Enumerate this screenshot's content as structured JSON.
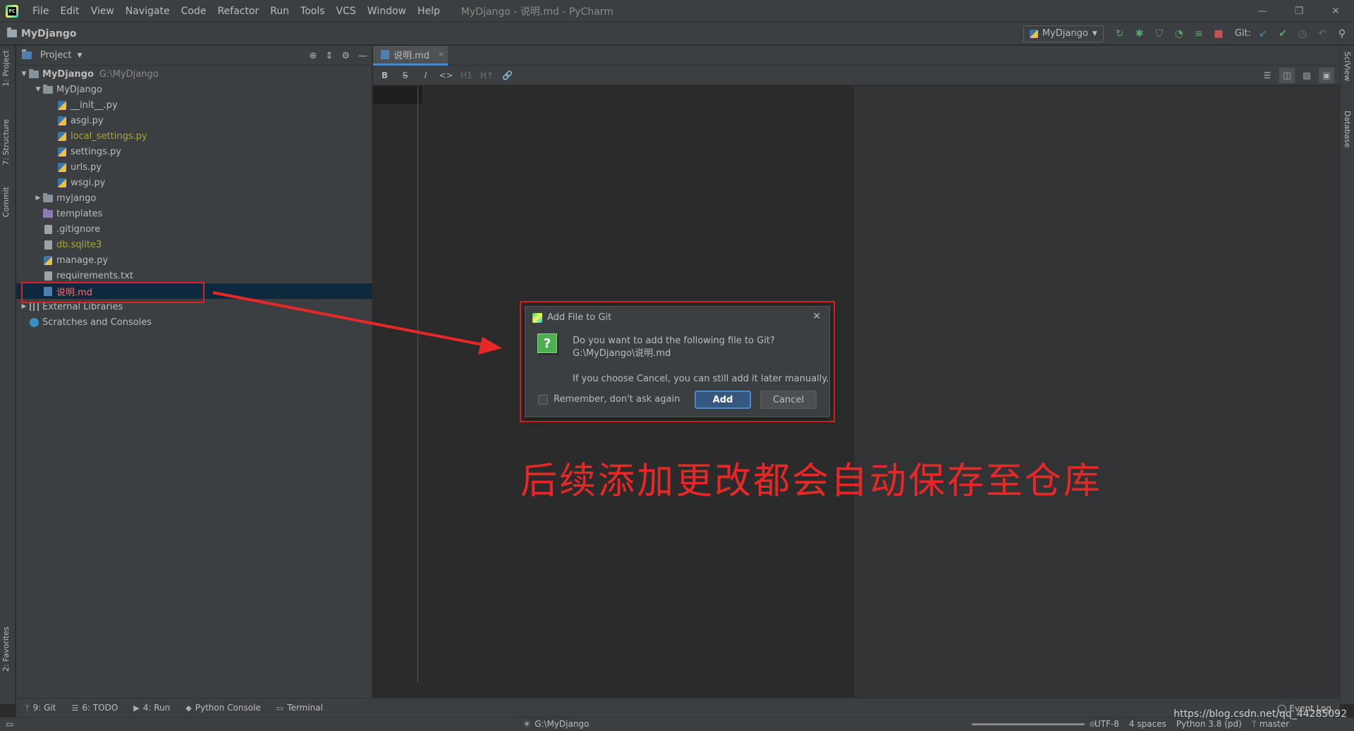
{
  "window": {
    "menu": [
      "File",
      "Edit",
      "View",
      "Navigate",
      "Code",
      "Refactor",
      "Run",
      "Tools",
      "VCS",
      "Window",
      "Help"
    ],
    "title": "MyDjango - 说明.md - PyCharm",
    "controls": {
      "minimize": "—",
      "restore": "❐",
      "close": "✕"
    }
  },
  "navbar": {
    "project": "MyDjango",
    "run_config": "MyDjango",
    "git_label": "Git:"
  },
  "left_tabs": {
    "project": "1: Project",
    "structure": "7: Structure",
    "commit": "Commit",
    "favorites": "2: Favorites"
  },
  "right_tabs": {
    "sciview": "SciView",
    "database": "Database"
  },
  "project_panel": {
    "title": "Project",
    "tree": [
      {
        "label": "MyDjango",
        "extra": "G:\\MyDjango",
        "type": "folder",
        "depth": 0,
        "expanded": true,
        "bold": true
      },
      {
        "label": "MyDjango",
        "type": "folder",
        "depth": 1,
        "expanded": true
      },
      {
        "label": "__init__.py",
        "type": "py",
        "depth": 2
      },
      {
        "label": "asgi.py",
        "type": "py",
        "depth": 2
      },
      {
        "label": "local_settings.py",
        "type": "py",
        "depth": 2,
        "color": "yellow"
      },
      {
        "label": "settings.py",
        "type": "py",
        "depth": 2
      },
      {
        "label": "urls.py",
        "type": "py",
        "depth": 2
      },
      {
        "label": "wsgi.py",
        "type": "py",
        "depth": 2
      },
      {
        "label": "myjango",
        "type": "folder",
        "depth": 1,
        "expanded": false
      },
      {
        "label": "templates",
        "type": "folder-purple",
        "depth": 1
      },
      {
        "label": ".gitignore",
        "type": "file",
        "depth": 1
      },
      {
        "label": "db.sqlite3",
        "type": "file",
        "depth": 1,
        "color": "yellow"
      },
      {
        "label": "manage.py",
        "type": "py",
        "depth": 1
      },
      {
        "label": "requirements.txt",
        "type": "file",
        "depth": 1
      },
      {
        "label": "说明.md",
        "type": "md",
        "depth": 1,
        "color": "red",
        "selected": true
      },
      {
        "label": "External Libraries",
        "type": "lib",
        "depth": 0,
        "expanded": false
      },
      {
        "label": "Scratches and Consoles",
        "type": "scratch",
        "depth": 0
      }
    ]
  },
  "editor": {
    "tab_label": "说明.md",
    "md_tools": [
      "B",
      "S",
      "I",
      "<>",
      "H1",
      "H↑",
      "🔗"
    ]
  },
  "dialog": {
    "title": "Add File to Git",
    "message_line1": "Do you want to add the following file to Git?",
    "message_line2": "G:\\MyDjango\\说明.md",
    "message_line3": "If you choose Cancel, you can still add it later manually.",
    "remember_label": "Remember, don't ask again",
    "add_label": "Add",
    "cancel_label": "Cancel"
  },
  "annotation": "后续添加更改都会自动保存至仓库",
  "toolwindows": [
    {
      "label": "9: Git",
      "icon": "git-branch-icon"
    },
    {
      "label": "6: TODO",
      "icon": "list-icon"
    },
    {
      "label": "4: Run",
      "icon": "run-icon"
    },
    {
      "label": "Python Console",
      "icon": "python-icon"
    },
    {
      "label": "Terminal",
      "icon": "terminal-icon"
    }
  ],
  "event_log": "Event Log",
  "status": {
    "path": "G:\\MyDjango",
    "encoding": "UTF-8",
    "indent": "4 spaces",
    "interpreter": "Python 3.8 (pd)",
    "branch": "master"
  },
  "watermark": "https://blog.csdn.net/qq_44285092"
}
